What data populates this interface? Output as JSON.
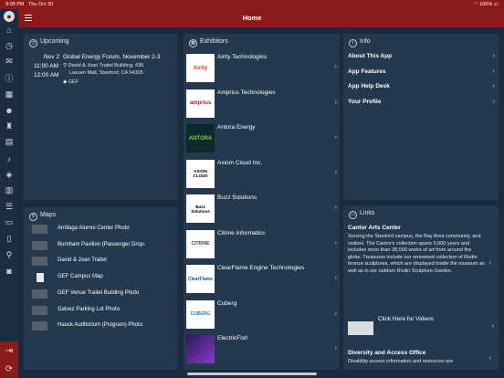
{
  "status": {
    "time": "9:09 PM",
    "date": "Thu Oct 20",
    "battery": "100%"
  },
  "header": {
    "title": "Home"
  },
  "upcoming": {
    "title": "Upcoming",
    "date": "Nov 2",
    "event": "Global Energy Forum, November 2-3",
    "time1": "11:00 AM",
    "time2": "12:00 AM",
    "location_line1": "David & Joan Traitel Building, 435",
    "location_line2": "Lasuen Mall, Stanford, CA 94305",
    "tag": "GEF"
  },
  "maps": {
    "title": "Maps",
    "items": [
      {
        "label": "Arrillaga Alumni Center Photo"
      },
      {
        "label": "Burnham Pavilion (Passenger Drop-"
      },
      {
        "label": "David & Joan Traitel"
      },
      {
        "label": "GEF Campus Map"
      },
      {
        "label": "GEF Venue Traitel Building Photo"
      },
      {
        "label": "Galvez Parking Lot Photo"
      },
      {
        "label": "Hauck Auditorium (Program) Photo"
      }
    ]
  },
  "exhibitors": {
    "title": "Exhibitors",
    "items": [
      {
        "name": "Airity Technologies",
        "logo": "Airity",
        "logo_color": "#d0362c"
      },
      {
        "name": "Amprius Technologies",
        "logo": "amprius",
        "logo_color": "#b22222"
      },
      {
        "name": "Antora Energy",
        "logo": "ANTORA",
        "logo_color": "#8dc43f"
      },
      {
        "name": "Axiom Cloud Inc.",
        "logo": "AXIOM CLOUD",
        "logo_color": "#111111"
      },
      {
        "name": "Buzz Solutions",
        "logo": "Buzz Solutions",
        "logo_color": "#111111"
      },
      {
        "name": "Citrine Informatics",
        "logo": "CITRINE",
        "logo_color": "#444444"
      },
      {
        "name": "ClearFlame Engine Technologies",
        "logo": "ClearFlame",
        "logo_color": "#1a4f8f"
      },
      {
        "name": "Cuberg",
        "logo": "CUBERG",
        "logo_color": "#1a7bc8"
      },
      {
        "name": "ElectricFish",
        "logo": "",
        "logo_color": "#5b2a86"
      }
    ]
  },
  "info": {
    "title": "Info",
    "items": [
      {
        "label": "About This App"
      },
      {
        "label": "App Features"
      },
      {
        "label": "App Help Desk"
      },
      {
        "label": "Your Profile"
      }
    ]
  },
  "links": {
    "title": "Links",
    "cantor_title": "Cantor Arts Center",
    "cantor_text": "Serving the Stanford campus, the Bay Area community, and visitors. The Cantor's collection spans 5,000 years and includes more than 38,000 works of art from around the globe. Treasures include our renowned collection of Rodin bronze sculptures, which are displayed inside the museum as well as in our outdoor Rodin Sculpture Garden.",
    "video_label": "Click Here for Videos",
    "diversity_title": "Diversity and Access Office",
    "diversity_text": "Disability access information and resources are"
  }
}
